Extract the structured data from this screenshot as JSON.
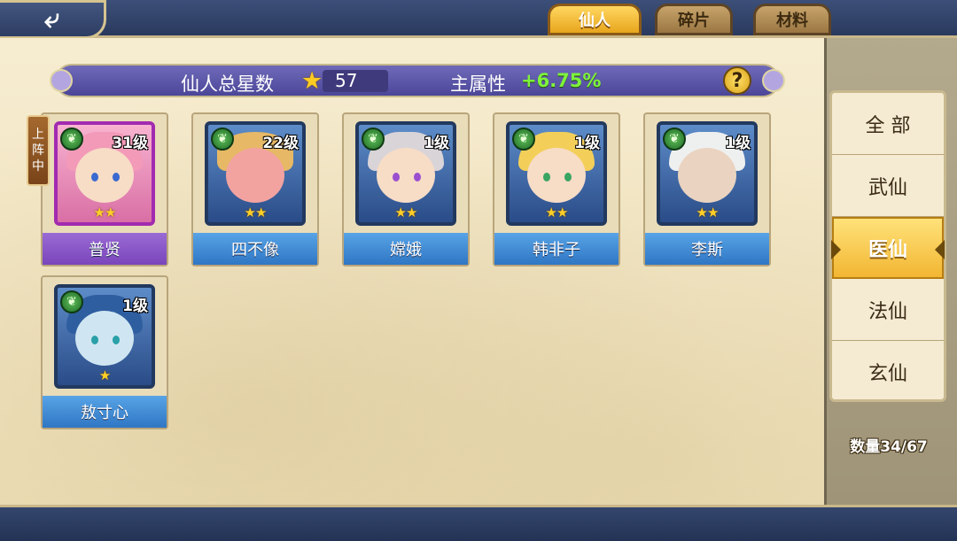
{
  "header": {
    "back_icon": "back-arrow-icon",
    "tabs": [
      {
        "label": "仙人",
        "active": true
      },
      {
        "label": "碎片",
        "active": false
      },
      {
        "label": "材料",
        "active": false
      }
    ]
  },
  "summary": {
    "total_stars_label": "仙人总星数",
    "total_stars_value": "57",
    "main_attr_label": "主属性",
    "main_attr_value": "+6.75%",
    "help_symbol": "?",
    "colors": {
      "attr_value": "#7ef23c",
      "star": "#ffcc22"
    }
  },
  "deployed_tag": {
    "chars": [
      "上",
      "阵",
      "中"
    ]
  },
  "heroes": [
    {
      "name": "普贤",
      "level": "31级",
      "stars": "★★",
      "star_count": 2,
      "frame": "purple",
      "deployed": true
    },
    {
      "name": "四不像",
      "level": "22级",
      "stars": "★★",
      "star_count": 2,
      "frame": "blue",
      "deployed": false
    },
    {
      "name": "嫦娥",
      "level": "1级",
      "stars": "★★",
      "star_count": 2,
      "frame": "blue",
      "deployed": false
    },
    {
      "name": "韩非子",
      "level": "1级",
      "stars": "★★",
      "star_count": 2,
      "frame": "blue",
      "deployed": false
    },
    {
      "name": "李斯",
      "level": "1级",
      "stars": "★★",
      "star_count": 2,
      "frame": "blue",
      "deployed": false
    },
    {
      "name": "敖寸心",
      "level": "1级",
      "stars": "★",
      "star_count": 1,
      "frame": "blue",
      "deployed": false
    }
  ],
  "filters": {
    "items": [
      {
        "label": "全 部",
        "selected": false
      },
      {
        "label": "武仙",
        "selected": false
      },
      {
        "label": "医仙",
        "selected": true
      },
      {
        "label": "法仙",
        "selected": false
      },
      {
        "label": "玄仙",
        "selected": false
      }
    ],
    "count_text": "数量34/67"
  }
}
